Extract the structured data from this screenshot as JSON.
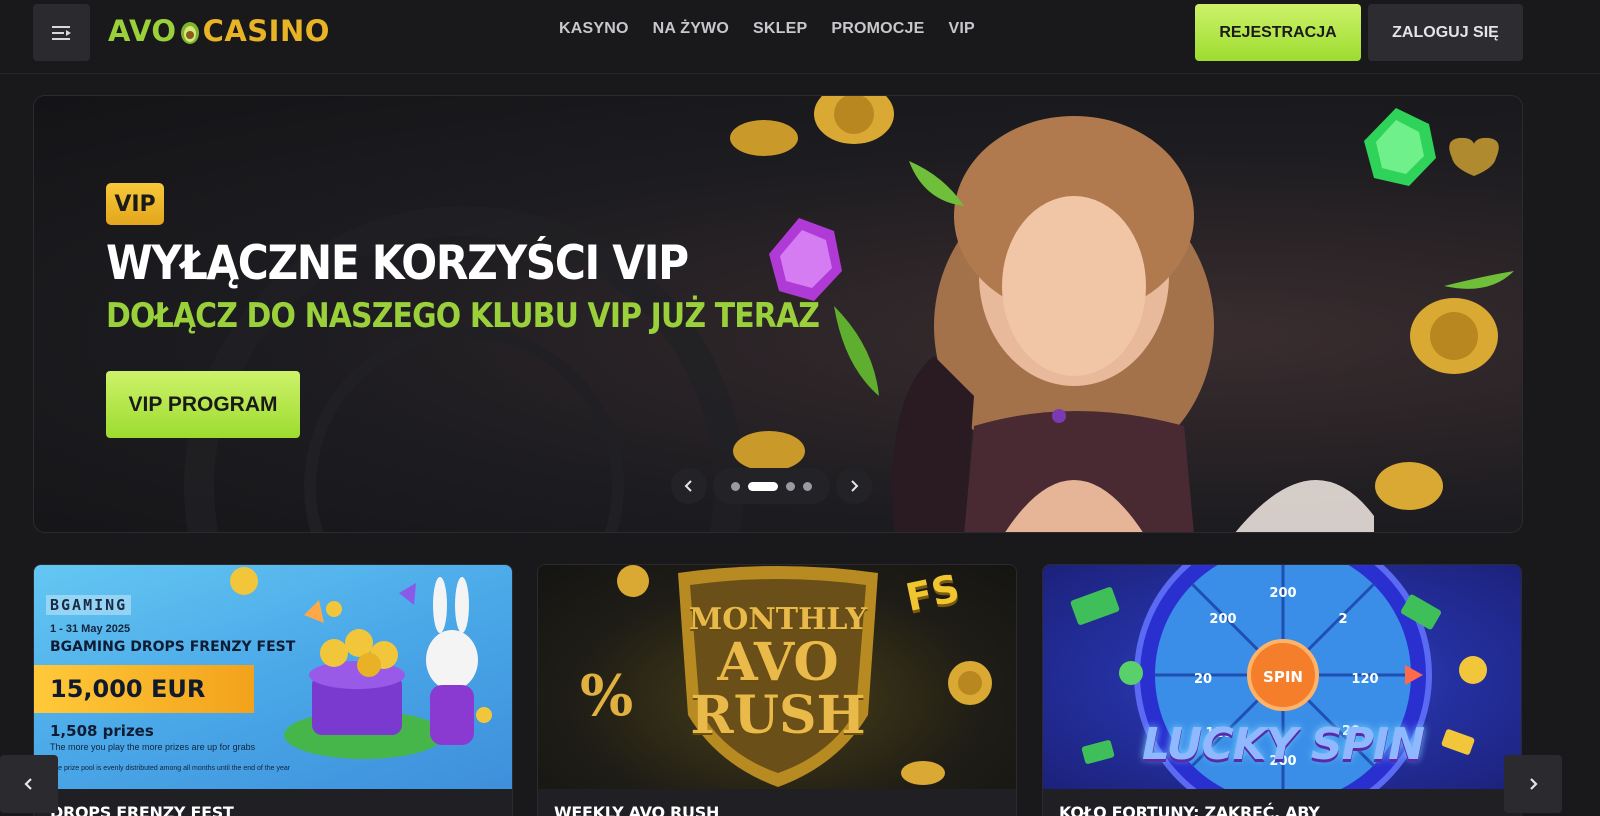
{
  "header": {
    "logo_left": "AVO",
    "logo_right": "CASINO",
    "nav": [
      "KASYNO",
      "NA ŻYWO",
      "SKLEP",
      "PROMOCJE",
      "VIP"
    ],
    "register_label": "REJESTRACJA",
    "login_label": "ZALOGUJ SIĘ"
  },
  "hero": {
    "badge": "VIP",
    "title": "WYŁĄCZNE KORZYŚCI VIP",
    "subtitle": "DOŁĄCZ DO NASZEGO KLUBU VIP JUŻ TERAZ",
    "button_label": "VIP PROGRAM",
    "slides_count": 4,
    "active_slide": 2
  },
  "cards": [
    {
      "caption": "DROPS FRENZY FEST",
      "brand": "BGAMING",
      "dates": "1 - 31 May 2025",
      "title": "BGAMING DROPS FRENZY FEST",
      "prize": "15,000 EUR",
      "prizes_count": "1,508 prizes",
      "small_text": "The more you play the more prizes are up for grabs",
      "tiny_text": "The prize pool is evenly distributed among all months until the end of the year"
    },
    {
      "caption": "WEEKLY AVO RUSH",
      "line1": "MONTHLY",
      "line2": "AVO",
      "line3": "RUSH",
      "badge": "FS"
    },
    {
      "caption": "KOŁO FORTUNY: ZAKRĘĆ, ABY",
      "center": "SPIN",
      "segments": [
        "200",
        "2",
        "120",
        "20",
        "200",
        "120",
        "20",
        "200"
      ],
      "title": "LUCKY SPIN"
    }
  ],
  "colors": {
    "background": "#19191c",
    "accent_green": "#9ad13a",
    "accent_gold": "#e8b426",
    "button_dark": "#2c2c31"
  }
}
